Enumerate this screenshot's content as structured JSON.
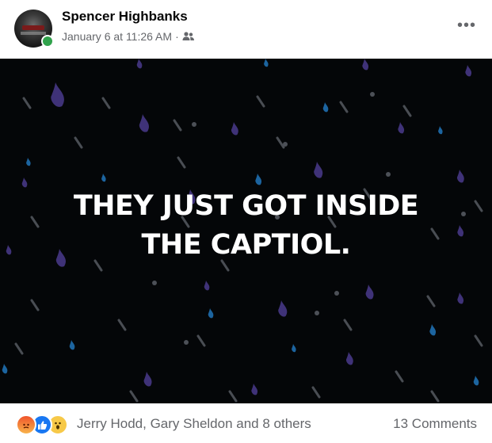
{
  "post": {
    "author": "Spencer Highbanks",
    "timestamp": "January 6 at 11:26 AM",
    "separator": "·",
    "audience_icon": "friends-icon",
    "more_icon": "more-options-icon",
    "more_label": "•••",
    "text": "THEY JUST GOT INSIDE THE CAPTIOL.",
    "background": "rain-drops-dark"
  },
  "footer": {
    "reactions": [
      "angry-reaction-icon",
      "like-reaction-icon",
      "wow-reaction-icon"
    ],
    "reaction_names": "Jerry Hodd, Gary Sheldon and 8 others",
    "comments": "13 Comments"
  },
  "colors": {
    "background": "#040608",
    "drop_purple": "#4a3b8c",
    "drop_blue": "#1f6fb0",
    "online": "#31a24c"
  }
}
